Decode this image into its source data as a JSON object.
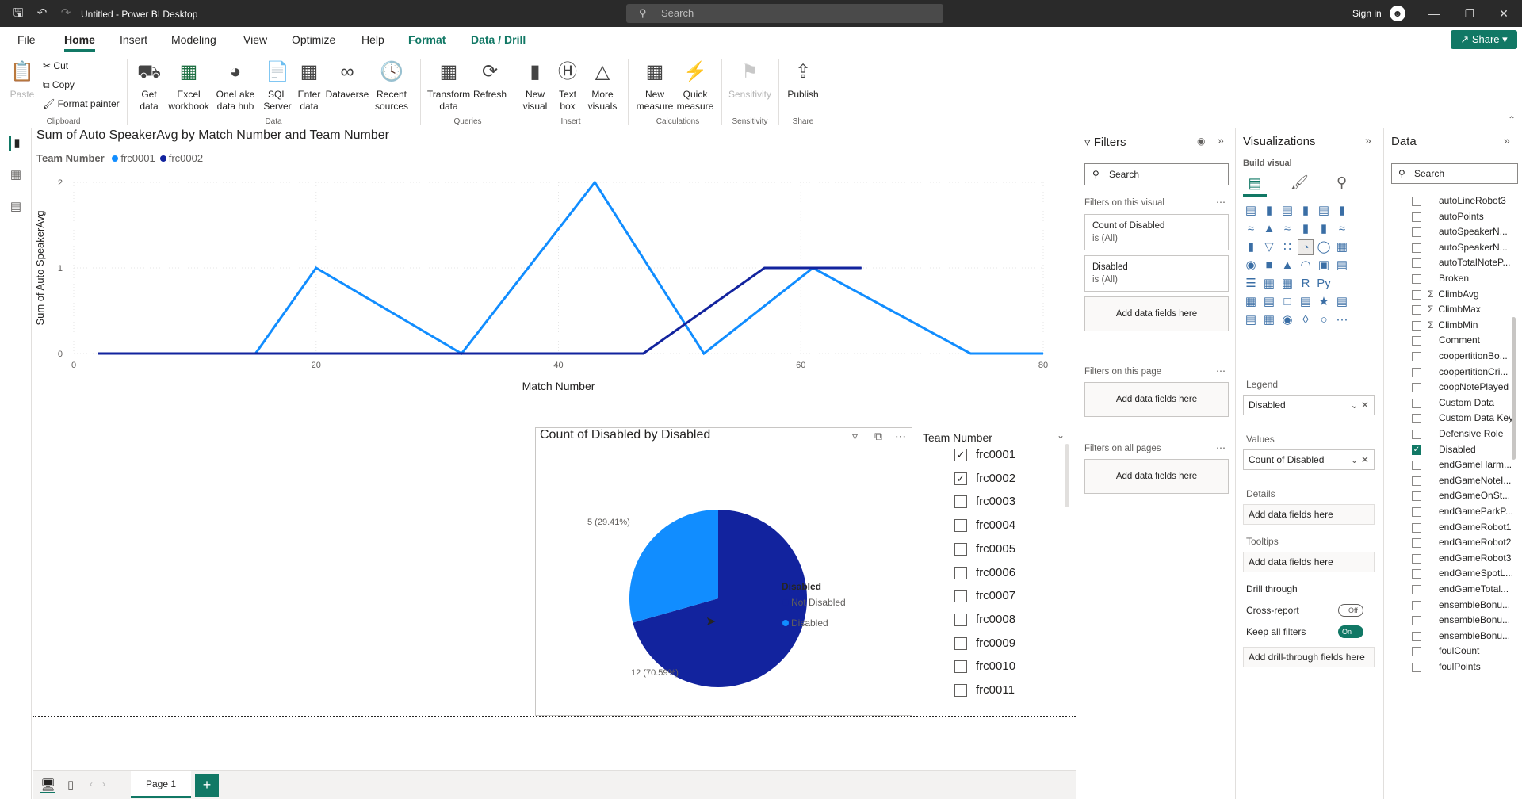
{
  "titlebar": {
    "title": "Untitled - Power BI Desktop",
    "search_placeholder": "Search",
    "sign_in": "Sign in"
  },
  "menu": {
    "tabs": [
      "File",
      "Home",
      "Insert",
      "Modeling",
      "View",
      "Optimize",
      "Help",
      "Format",
      "Data / Drill"
    ],
    "active": "Home",
    "share": "Share"
  },
  "ribbon": {
    "clipboard": {
      "paste": "Paste",
      "cut": "Cut",
      "copy": "Copy",
      "format_painter": "Format painter",
      "group": "Clipboard"
    },
    "data": {
      "get_data": "Get data",
      "excel": "Excel workbook",
      "onelake": "OneLake data hub",
      "sql": "SQL Server",
      "enter": "Enter data",
      "dataverse": "Dataverse",
      "recent": "Recent sources",
      "group": "Data"
    },
    "queries": {
      "transform": "Transform data",
      "refresh": "Refresh",
      "group": "Queries"
    },
    "insert": {
      "new_visual": "New visual",
      "text_box": "Text box",
      "more_visuals": "More visuals",
      "group": "Insert"
    },
    "calc": {
      "new_measure": "New measure",
      "quick_measure": "Quick measure",
      "group": "Calculations"
    },
    "sens": {
      "sensitivity": "Sensitivity",
      "group": "Sensitivity"
    },
    "share": {
      "publish": "Publish",
      "group": "Share"
    }
  },
  "line_visual": {
    "title": "Sum of Auto SpeakerAvg by Match Number and Team Number",
    "legend_title": "Team Number"
  },
  "pie_visual": {
    "title": "Count of Disabled by Disabled",
    "legend_title": "Disabled"
  },
  "slicer": {
    "title": "Team Number",
    "items": [
      {
        "label": "frc0001",
        "checked": true
      },
      {
        "label": "frc0002",
        "checked": true
      },
      {
        "label": "frc0003",
        "checked": false
      },
      {
        "label": "frc0004",
        "checked": false
      },
      {
        "label": "frc0005",
        "checked": false
      },
      {
        "label": "frc0006",
        "checked": false
      },
      {
        "label": "frc0007",
        "checked": false
      },
      {
        "label": "frc0008",
        "checked": false
      },
      {
        "label": "frc0009",
        "checked": false
      },
      {
        "label": "frc0010",
        "checked": false
      },
      {
        "label": "frc0011",
        "checked": false
      }
    ]
  },
  "chart_data": [
    {
      "type": "line",
      "title": "Sum of Auto SpeakerAvg by Match Number and Team Number",
      "xlabel": "Match Number",
      "ylabel": "Sum of Auto SpeakerAvg",
      "xlim": [
        0,
        80
      ],
      "ylim": [
        0,
        2
      ],
      "xticks": [
        "0",
        "20",
        "40",
        "60",
        "80"
      ],
      "yticks": [
        "0",
        "1",
        "2"
      ],
      "series": [
        {
          "name": "frc0001",
          "color": "#118dff",
          "x": [
            2,
            15,
            20,
            32,
            43,
            52,
            61,
            74,
            80
          ],
          "y": [
            0,
            0,
            1,
            0,
            2,
            0,
            1,
            0,
            0
          ]
        },
        {
          "name": "frc0002",
          "color": "#12239e",
          "x": [
            2,
            47,
            57,
            65
          ],
          "y": [
            0,
            0,
            1,
            1
          ]
        }
      ]
    },
    {
      "type": "pie",
      "title": "Count of Disabled by Disabled",
      "categories": [
        "Not Disabled",
        "Disabled"
      ],
      "values": [
        12,
        5
      ],
      "labels": [
        "12 (70.59%)",
        "5 (29.41%)"
      ],
      "colors": [
        "#12239e",
        "#118dff"
      ]
    }
  ],
  "pagebar": {
    "page": "Page 1"
  },
  "filters": {
    "title": "Filters",
    "search": "Search",
    "on_visual": "Filters on this visual",
    "card1_name": "Count of Disabled",
    "card1_val": "is (All)",
    "card2_name": "Disabled",
    "card2_val": "is (All)",
    "add": "Add data fields here",
    "on_page": "Filters on this page",
    "on_all": "Filters on all pages"
  },
  "viz": {
    "title": "Visualizations",
    "build": "Build visual",
    "legend": "Legend",
    "legend_field": "Disabled",
    "values": "Values",
    "values_field": "Count of Disabled",
    "details": "Details",
    "tooltips": "Tooltips",
    "add": "Add data fields here",
    "drill": "Drill through",
    "cross": "Cross-report",
    "cross_state": "Off",
    "keep": "Keep all filters",
    "keep_state": "On",
    "add_drill": "Add drill-through fields here"
  },
  "data": {
    "title": "Data",
    "search": "Search",
    "fields": [
      {
        "label": "autoLineRobot3",
        "sigma": false,
        "checked": false
      },
      {
        "label": "autoPoints",
        "sigma": false,
        "checked": false
      },
      {
        "label": "autoSpeakerN...",
        "sigma": false,
        "checked": false
      },
      {
        "label": "autoSpeakerN...",
        "sigma": false,
        "checked": false
      },
      {
        "label": "autoTotalNoteP...",
        "sigma": false,
        "checked": false
      },
      {
        "label": "Broken",
        "sigma": false,
        "checked": false
      },
      {
        "label": "ClimbAvg",
        "sigma": true,
        "checked": false
      },
      {
        "label": "ClimbMax",
        "sigma": true,
        "checked": false
      },
      {
        "label": "ClimbMin",
        "sigma": true,
        "checked": false
      },
      {
        "label": "Comment",
        "sigma": false,
        "checked": false
      },
      {
        "label": "coopertitionBo...",
        "sigma": false,
        "checked": false
      },
      {
        "label": "coopertitionCri...",
        "sigma": false,
        "checked": false
      },
      {
        "label": "coopNotePlayed",
        "sigma": false,
        "checked": false
      },
      {
        "label": "Custom Data",
        "sigma": false,
        "checked": false
      },
      {
        "label": "Custom Data Key",
        "sigma": false,
        "checked": false
      },
      {
        "label": "Defensive Role",
        "sigma": false,
        "checked": false
      },
      {
        "label": "Disabled",
        "sigma": false,
        "checked": true
      },
      {
        "label": "endGameHarm...",
        "sigma": false,
        "checked": false
      },
      {
        "label": "endGameNoteI...",
        "sigma": false,
        "checked": false
      },
      {
        "label": "endGameOnSt...",
        "sigma": false,
        "checked": false
      },
      {
        "label": "endGameParkP...",
        "sigma": false,
        "checked": false
      },
      {
        "label": "endGameRobot1",
        "sigma": false,
        "checked": false
      },
      {
        "label": "endGameRobot2",
        "sigma": false,
        "checked": false
      },
      {
        "label": "endGameRobot3",
        "sigma": false,
        "checked": false
      },
      {
        "label": "endGameSpotL...",
        "sigma": false,
        "checked": false
      },
      {
        "label": "endGameTotal...",
        "sigma": false,
        "checked": false
      },
      {
        "label": "ensembleBonu...",
        "sigma": false,
        "checked": false
      },
      {
        "label": "ensembleBonu...",
        "sigma": false,
        "checked": false
      },
      {
        "label": "ensembleBonu...",
        "sigma": false,
        "checked": false
      },
      {
        "label": "foulCount",
        "sigma": false,
        "checked": false
      },
      {
        "label": "foulPoints",
        "sigma": false,
        "checked": false
      }
    ]
  }
}
